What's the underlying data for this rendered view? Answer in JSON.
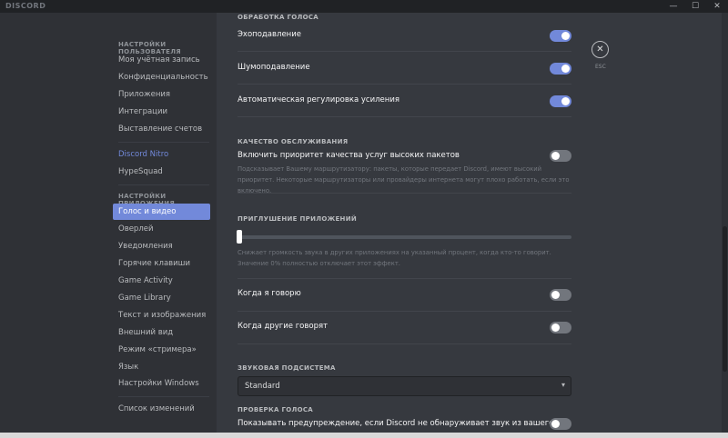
{
  "window": {
    "logo": "DISCORD",
    "min": "—",
    "max": "☐",
    "close": "✕"
  },
  "sidebar": {
    "user_header": "НАСТРОЙКИ ПОЛЬЗОВАТЕЛЯ",
    "user_items": [
      "Моя учётная запись",
      "Конфиденциальность",
      "Приложения",
      "Интеграции",
      "Выставление счетов"
    ],
    "nitro": "Discord Nitro",
    "hypesquad": "HypeSquad",
    "app_header": "НАСТРОЙКИ ПРИЛОЖЕНИЯ",
    "app_items": [
      "Голос и видео",
      "Оверлей",
      "Уведомления",
      "Горячие клавиши",
      "Game Activity",
      "Game Library",
      "Текст и изображения",
      "Внешний вид",
      "Режим «стримера»",
      "Язык",
      "Настройки Windows"
    ],
    "changelog": "Список изменений"
  },
  "content": {
    "voice_processing_header": "ОБРАБОТКА ГОЛОСА",
    "echo_cancel": {
      "label": "Эхоподавление",
      "on": true
    },
    "noise_suppression": {
      "label": "Шумоподавление",
      "on": true
    },
    "auto_gain": {
      "label": "Автоматическая регулировка усиления",
      "on": true
    },
    "qos_header": "КАЧЕСТВО ОБСЛУЖИВАНИЯ",
    "qos_toggle": {
      "label": "Включить приоритет качества услуг высоких пакетов",
      "on": false
    },
    "qos_note": "Подсказывает Вашему маршрутизатору: пакеты, которые передает Discord, имеют высокий приоритет. Некоторые маршрутизаторы или провайдеры интернета могут плохо работать, если это включено.",
    "attenuation_header": "ПРИГЛУШЕНИЕ ПРИЛОЖЕНИЙ",
    "attenuation_value": 0,
    "attenuation_note": "Снижает громкость звука в других приложениях на указанный процент, когда кто-то говорит. Значение 0% полностью отключает этот эффект.",
    "when_i_speak": {
      "label": "Когда я говорю",
      "on": false
    },
    "when_others_speak": {
      "label": "Когда другие говорят",
      "on": false
    },
    "audio_subsystem_header": "ЗВУКОВАЯ ПОДСИСТЕМА",
    "audio_subsystem_value": "Standard",
    "voice_check_header": "ПРОВЕРКА ГОЛОСА",
    "voice_warning": {
      "label": "Показывать предупреждение, если Discord не обнаруживает звук из вашего",
      "on": false
    }
  },
  "esc": {
    "icon": "✕",
    "label": "ESC"
  },
  "colors": {
    "accent": "#7289da",
    "background": "#36393f",
    "sidebar": "#2f3136"
  }
}
